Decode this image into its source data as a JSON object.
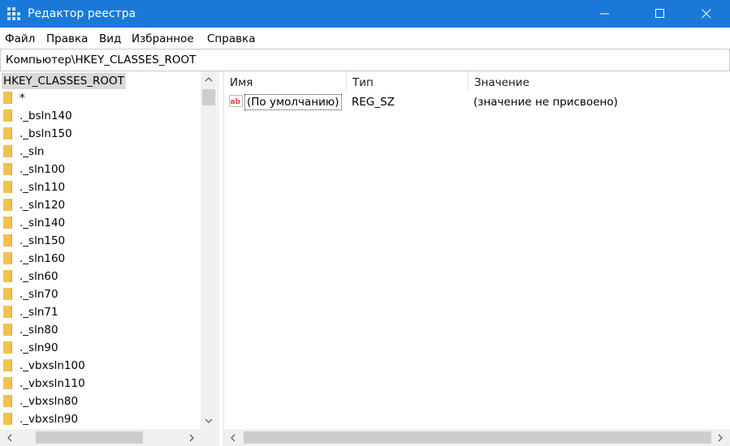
{
  "window": {
    "title": "Редактор реестра",
    "controls": [
      "minimize",
      "maximize",
      "close"
    ]
  },
  "menu": [
    "Файл",
    "Правка",
    "Вид",
    "Избранное",
    "Справка"
  ],
  "address": "Компьютер\\HKEY_CLASSES_ROOT",
  "tree": {
    "root": "HKEY_CLASSES_ROOT",
    "items": [
      "*",
      "._bsln140",
      "._bsln150",
      "._sln",
      "._sln100",
      "._sln110",
      "._sln120",
      "._sln140",
      "._sln150",
      "._sln160",
      "._sln60",
      "._sln70",
      "._sln71",
      "._sln80",
      "._sln90",
      "._vbxsln100",
      "._vbxsln110",
      "._vbxsln80",
      "._vbxsln90"
    ]
  },
  "values": {
    "columns": [
      "Имя",
      "Тип",
      "Значение"
    ],
    "rows": [
      {
        "name": "(По умолчанию)",
        "type": "REG_SZ",
        "data": "(значение не присвоено)",
        "icon": "reg-string-icon"
      }
    ]
  },
  "colors": {
    "titlebar": "#1a79d8",
    "selection": "#d9d9d9",
    "folder": "#f0c350",
    "scrollbar_track": "#f0f0f0",
    "scrollbar_thumb": "#cdcdcd"
  }
}
